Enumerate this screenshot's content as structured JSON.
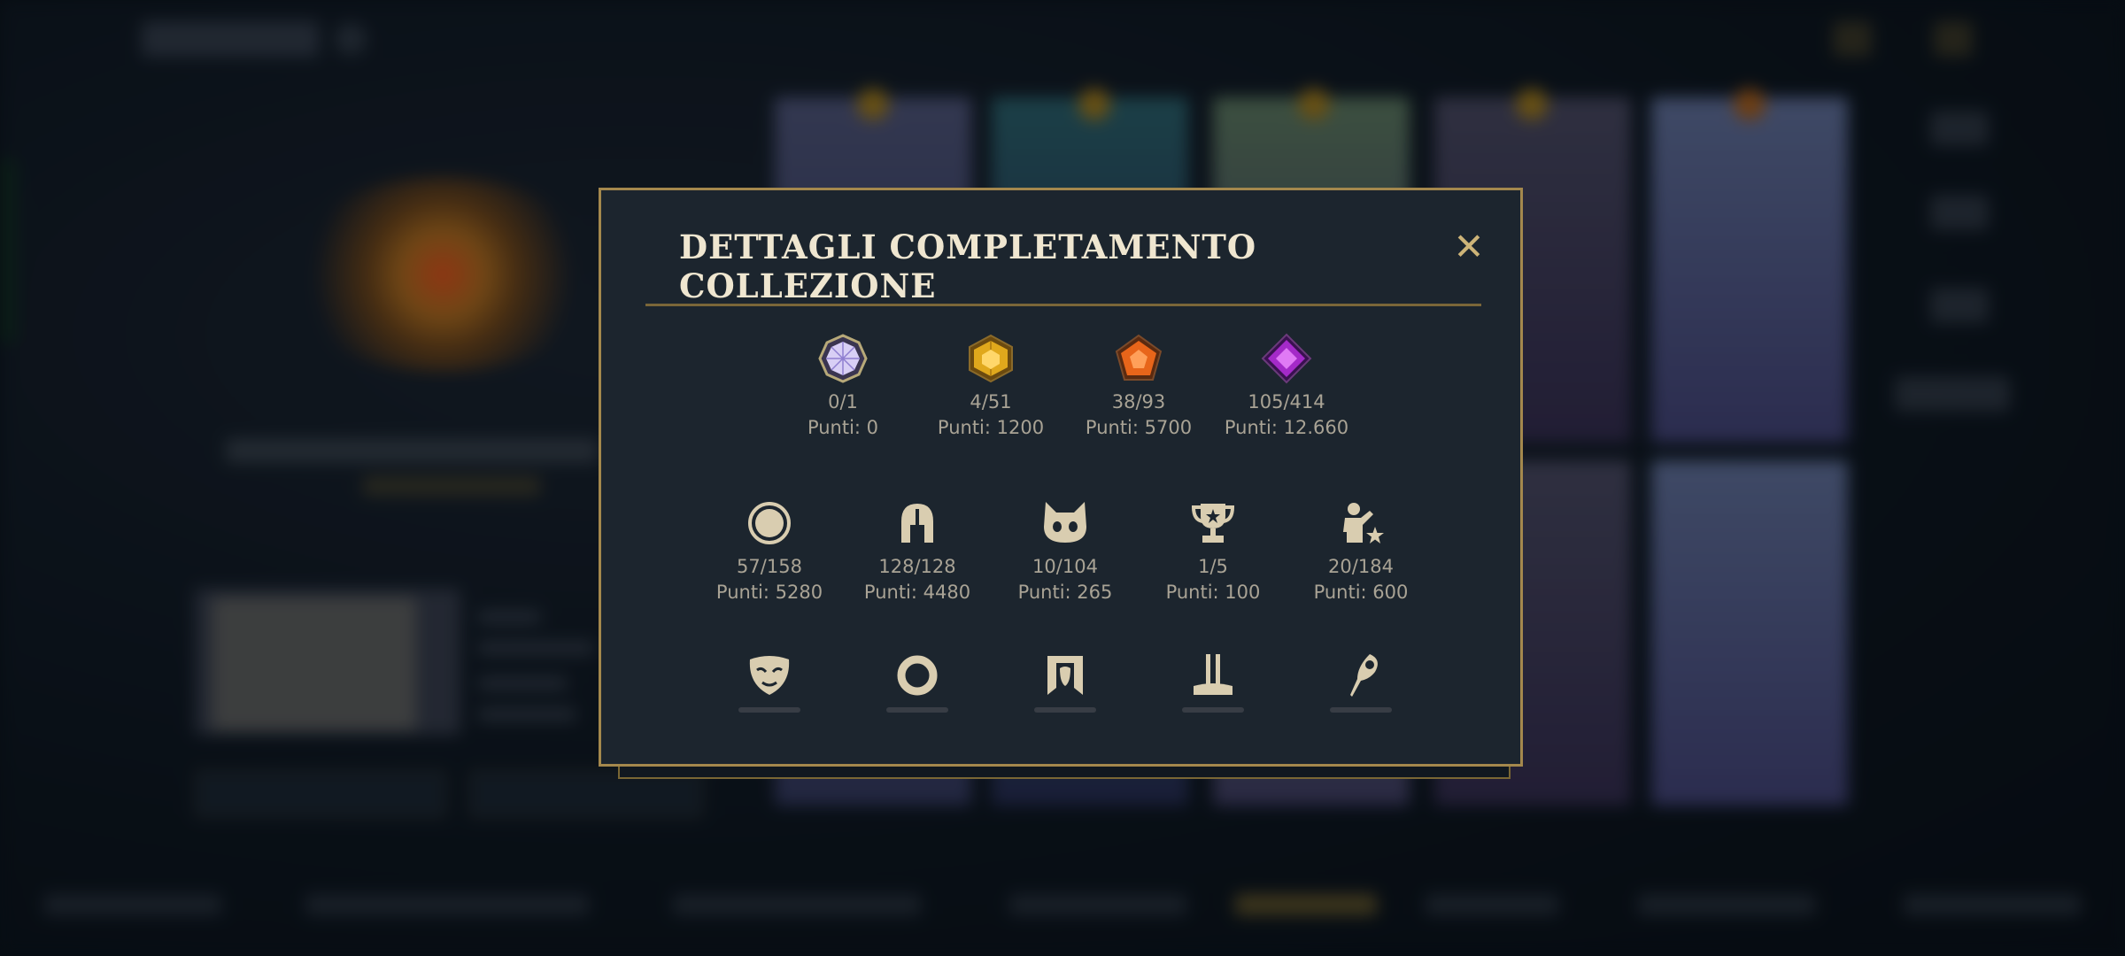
{
  "dialog": {
    "title": "DETTAGLI COMPLETAMENTO COLLEZIONE",
    "close_glyph": "✕"
  },
  "gem_rarities": [
    {
      "icon": "white-gem-icon",
      "count": "0/1",
      "points": "Punti: 0",
      "color": "#c8b8f0"
    },
    {
      "icon": "gold-gem-icon",
      "count": "4/51",
      "points": "Punti: 1200",
      "color": "#e0a81c"
    },
    {
      "icon": "orange-gem-icon",
      "count": "38/93",
      "points": "Punti: 5700",
      "color": "#e8651a"
    },
    {
      "icon": "purple-gem-icon",
      "count": "105/414",
      "points": "Punti: 12.660",
      "color": "#a42ac8"
    }
  ],
  "categories": [
    {
      "icon": "circle-icon",
      "count": "57/158",
      "points": "Punti: 5280"
    },
    {
      "icon": "helmet-icon",
      "count": "128/128",
      "points": "Punti: 4480"
    },
    {
      "icon": "creature-icon",
      "count": "10/104",
      "points": "Punti: 265"
    },
    {
      "icon": "trophy-icon",
      "count": "1/5",
      "points": "Punti: 100"
    },
    {
      "icon": "emote-icon",
      "count": "20/184",
      "points": "Punti: 600"
    }
  ],
  "more_categories": [
    {
      "icon": "mask-icon"
    },
    {
      "icon": "ring-icon"
    },
    {
      "icon": "banner-icon"
    },
    {
      "icon": "pillar-icon"
    },
    {
      "icon": "quill-icon"
    }
  ],
  "colors": {
    "accent_gold": "#a4884d",
    "panel_bg": "#1c252e",
    "text_muted": "#a9a395",
    "title_text": "#efe6d0"
  }
}
